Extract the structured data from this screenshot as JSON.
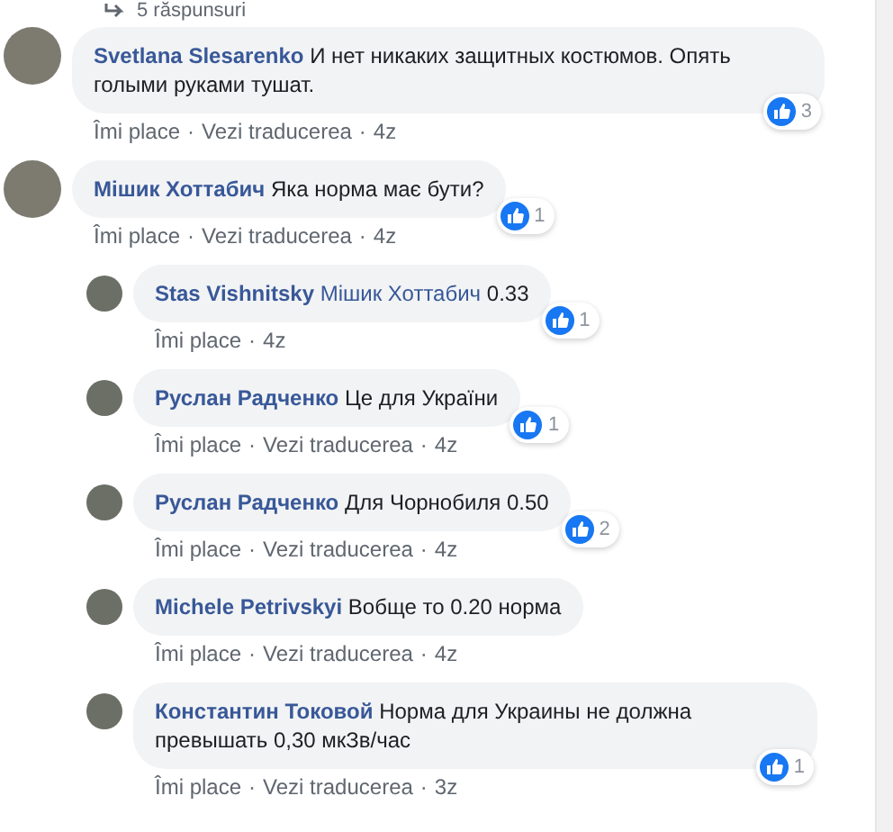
{
  "replies_link": {
    "label": "5 răspunsuri"
  },
  "comments": [
    {
      "author": "Svetlana Slesarenko",
      "text": "И нет никаких защитных костюмов. Опять голыми руками тушат.",
      "footer": [
        "Îmi place",
        "·",
        "Vezi traducerea",
        "·",
        "4z"
      ],
      "likes": "3"
    },
    {
      "author": "Мішик Хоттабич",
      "text": "Яка норма має бути?",
      "footer": [
        "Îmi place",
        "·",
        "Vezi traducerea",
        "·",
        "4z"
      ],
      "likes": "1",
      "replies": [
        {
          "author": "Stas Vishnitsky",
          "mention": "Мішик Хоттабич",
          "text": "0.33",
          "footer": [
            "Îmi place",
            "·",
            "4z"
          ],
          "likes": "1"
        },
        {
          "author": "Руслан Радченко",
          "text": "Це для України",
          "footer": [
            "Îmi place",
            "·",
            "Vezi traducerea",
            "·",
            "4z"
          ],
          "likes": "1"
        },
        {
          "author": "Руслан Радченко",
          "text": "Для Чорнобиля 0.50",
          "footer": [
            "Îmi place",
            "·",
            "Vezi traducerea",
            "·",
            "4z"
          ],
          "likes": "2"
        },
        {
          "author": "Michele Petrivskyi",
          "text": "Вобще то 0.20 норма",
          "footer": [
            "Îmi place",
            "·",
            "Vezi traducerea",
            "·",
            "4z"
          ]
        },
        {
          "author": "Константин Токовой",
          "text": "Норма для Украины не должна превышать 0,30 мкЗв/час",
          "footer": [
            "Îmi place",
            "·",
            "Vezi traducerea",
            "·",
            "3z"
          ],
          "likes": "1"
        }
      ]
    }
  ]
}
